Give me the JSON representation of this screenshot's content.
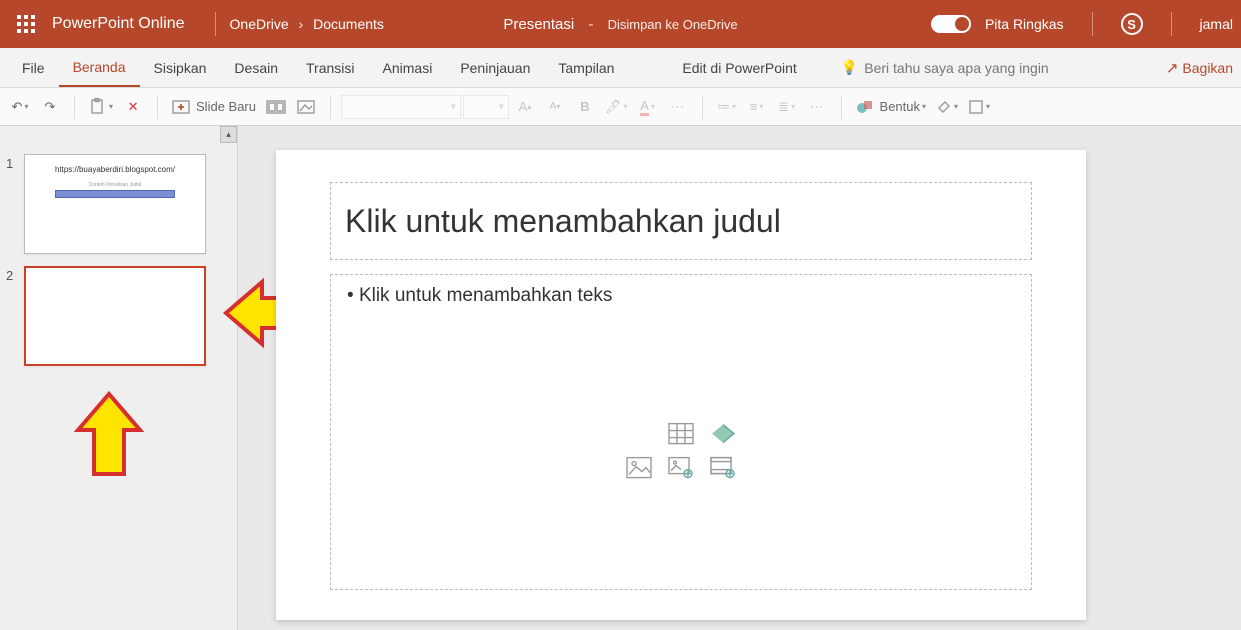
{
  "titlebar": {
    "app_name": "PowerPoint Online",
    "breadcrumb": {
      "root": "OneDrive",
      "folder": "Documents"
    },
    "doc_name": "Presentasi",
    "save_status": "Disimpan ke OneDrive",
    "ribbon_toggle_label": "Pita Ringkas",
    "user_name": "jamal"
  },
  "tabs": {
    "file": "File",
    "home": "Beranda",
    "insert": "Sisipkan",
    "design": "Desain",
    "transitions": "Transisi",
    "animations": "Animasi",
    "review": "Peninjauan",
    "view": "Tampilan",
    "edit_desktop": "Edit di PowerPoint",
    "tell_me": "Beri tahu saya apa yang ingin",
    "share": "Bagikan"
  },
  "toolbar": {
    "new_slide": "Slide Baru",
    "shape_label": "Bentuk"
  },
  "thumbnails": {
    "slide1": {
      "num": "1",
      "title_text": "https://buayaberdiri.blogspot.com/",
      "subtitle_text": "Contoh Penulisan Judul"
    },
    "slide2": {
      "num": "2"
    }
  },
  "slide": {
    "title_placeholder": "Klik untuk menambahkan judul",
    "body_placeholder": "Klik untuk menambahkan teks"
  },
  "colors": {
    "brand": "#b7472a"
  }
}
